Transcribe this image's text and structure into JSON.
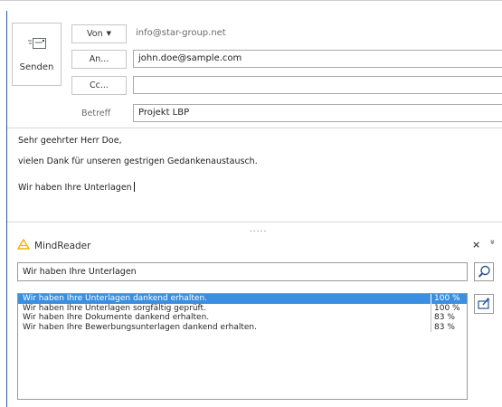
{
  "header": {
    "send_label": "Senden",
    "from_button": "Von",
    "from_value": "info@star-group.net",
    "to_button": "An...",
    "to_value": "john.doe@sample.com",
    "cc_button": "Cc...",
    "cc_value": "",
    "subject_label": "Betreff",
    "subject_value": "Projekt LBP"
  },
  "body": {
    "lines": [
      "Sehr geehrter Herr Doe,",
      "vielen Dank für unseren gestrigen Gedankenaustausch.",
      "Wir haben Ihre Unterlagen"
    ]
  },
  "splitter": ".....",
  "mindreader": {
    "title": "MindReader",
    "accent_color": "#f0b400",
    "search_value": "Wir haben Ihre Unterlagen",
    "close_glyph": "×",
    "collapse_glyph": "»",
    "suggestions": [
      {
        "text": "Wir haben Ihre Unterlagen dankend erhalten.",
        "score": "100 %",
        "selected": true
      },
      {
        "text": "Wir haben Ihre Unterlagen sorgfältig geprüft.",
        "score": "100 %",
        "selected": false
      },
      {
        "text": "Wir haben Ihre Dokumente dankend erhalten.",
        "score": "83 %",
        "selected": false
      },
      {
        "text": "Wir haben Ihre Bewerbungsunterlagen dankend erhalten.",
        "score": "83 %",
        "selected": false
      }
    ]
  },
  "colors": {
    "selection": "#3b8fe0",
    "border": "#9a9a9a"
  }
}
